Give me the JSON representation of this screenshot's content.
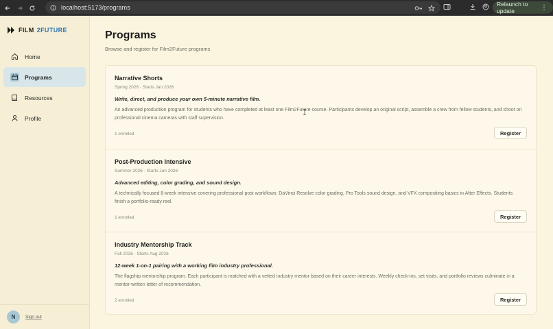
{
  "browser": {
    "url": "localhost:5173/programs",
    "relaunch_label": "Relaunch to update"
  },
  "sidebar": {
    "logo": {
      "word1": "FILM",
      "word2": "2FUTURE"
    },
    "items": [
      {
        "label": "Home",
        "icon": "home-icon",
        "active": false
      },
      {
        "label": "Programs",
        "icon": "calendar-icon",
        "active": true
      },
      {
        "label": "Resources",
        "icon": "book-icon",
        "active": false
      },
      {
        "label": "Profile",
        "icon": "user-icon",
        "active": false
      }
    ],
    "avatar_initial": "N",
    "signout_label": "Sign out"
  },
  "main": {
    "title": "Programs",
    "subtitle": "Browse and register for Film2Future programs",
    "programs": [
      {
        "title": "Narrative Shorts",
        "meta": "Spring 2026 · Starts Jan 2026",
        "tagline": "Write, direct, and produce your own 5-minute narrative film.",
        "description": "An advanced production program for students who have completed at least one Film2Future course. Participants develop an original script, assemble a crew from fellow students, and shoot on professional cinema cameras with staff supervision.",
        "enrolled": "1 enrolled",
        "button": "Register"
      },
      {
        "title": "Post-Production Intensive",
        "meta": "Summer 2026 · Starts Jun 2026",
        "tagline": "Advanced editing, color grading, and sound design.",
        "description": "A technically focused 8-week intensive covering professional post workflows: DaVinci Resolve color grading, Pro Tools sound design, and VFX compositing basics in After Effects. Students finish a portfolio-ready reel.",
        "enrolled": "1 enrolled",
        "button": "Register"
      },
      {
        "title": "Industry Mentorship Track",
        "meta": "Fall 2026 · Starts Aug 2026",
        "tagline": "12-week 1-on-1 pairing with a working film industry professional.",
        "description": "The flagship mentorship program. Each participant is matched with a vetted industry mentor based on their career interests. Weekly check-ins, set visits, and portfolio reviews culminate in a mentor-written letter of recommendation.",
        "enrolled": "2 enrolled",
        "button": "Register"
      }
    ]
  },
  "colors": {
    "sidebar_bg": "#f6efd6",
    "main_bg": "#fbf5df",
    "active_item_bg": "#d8e6ea",
    "logo_accent": "#2d72b0"
  }
}
